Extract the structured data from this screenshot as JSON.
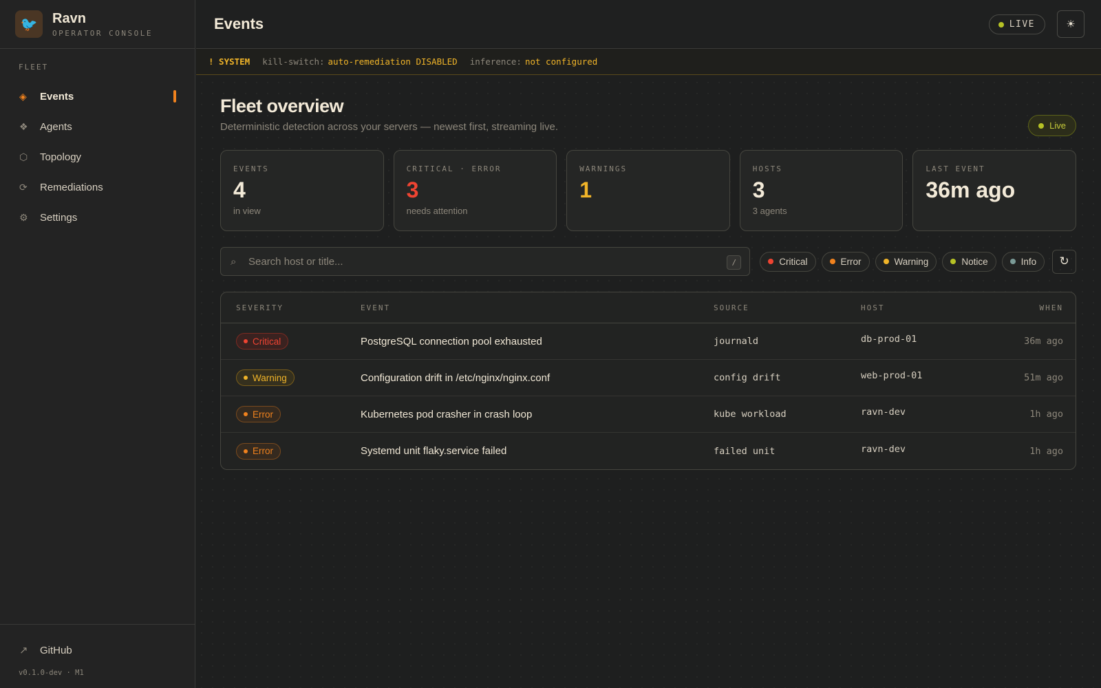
{
  "brand": {
    "name": "Ravn",
    "subtitle": "OPERATOR CONSOLE",
    "logo_icon": "bird-icon"
  },
  "sidebar": {
    "section": "FLEET",
    "items": [
      {
        "label": "Events",
        "icon": "◈",
        "active": true
      },
      {
        "label": "Agents",
        "icon": "❖"
      },
      {
        "label": "Topology",
        "icon": "⬡"
      },
      {
        "label": "Remediations",
        "icon": "⟳"
      },
      {
        "label": "Settings",
        "icon": "⚙"
      }
    ],
    "github_label": "GitHub",
    "version": "v0.1.0-dev · M1"
  },
  "header": {
    "title": "Events",
    "live_label": "LIVE"
  },
  "system": {
    "tag": "! SYSTEM",
    "killswitch_key": "kill-switch:",
    "killswitch_value": "auto-remediation DISABLED",
    "inference_key": "inference:",
    "inference_value": "not configured"
  },
  "overview": {
    "title": "Fleet overview",
    "subtitle": "Deterministic detection across your servers — newest first, streaming live.",
    "live_chip": "Live"
  },
  "stats": [
    {
      "label": "EVENTS",
      "value": "4",
      "sub": "in view"
    },
    {
      "label": "CRITICAL · ERROR",
      "value": "3",
      "sub": "needs attention"
    },
    {
      "label": "WARNINGS",
      "value": "1",
      "sub": ""
    },
    {
      "label": "HOSTS",
      "value": "3",
      "sub": "3 agents"
    },
    {
      "label": "LAST EVENT",
      "value": "36m ago",
      "sub": ""
    }
  ],
  "search": {
    "placeholder": "Search host or title...",
    "shortcut": "/"
  },
  "filters": [
    {
      "label": "Critical",
      "color": "#ef4432"
    },
    {
      "label": "Error",
      "color": "#f0821e"
    },
    {
      "label": "Warning",
      "color": "#f0b429"
    },
    {
      "label": "Notice",
      "color": "#b6c225"
    },
    {
      "label": "Info",
      "color": "#7a9a96"
    }
  ],
  "table": {
    "headers": {
      "severity": "SEVERITY",
      "event": "EVENT",
      "source": "SOURCE",
      "host": "HOST",
      "when": "WHEN"
    },
    "rows": [
      {
        "severity": "Critical",
        "event": "PostgreSQL connection pool exhausted",
        "source": "journald",
        "host": "db-prod-01",
        "when": "36m ago"
      },
      {
        "severity": "Warning",
        "event": "Configuration drift in /etc/nginx/nginx.conf",
        "source": "config drift",
        "host": "web-prod-01",
        "when": "51m ago"
      },
      {
        "severity": "Error",
        "event": "Kubernetes pod crasher in crash loop",
        "source": "kube workload",
        "host": "ravn-dev",
        "when": "1h ago"
      },
      {
        "severity": "Error",
        "event": "Systemd unit flaky.service failed",
        "source": "failed unit",
        "host": "ravn-dev",
        "when": "1h ago"
      }
    ]
  },
  "colors": {
    "accent": "#f0821e",
    "critical": "#ef4432",
    "warning": "#f0b429",
    "live": "#b6c225"
  }
}
